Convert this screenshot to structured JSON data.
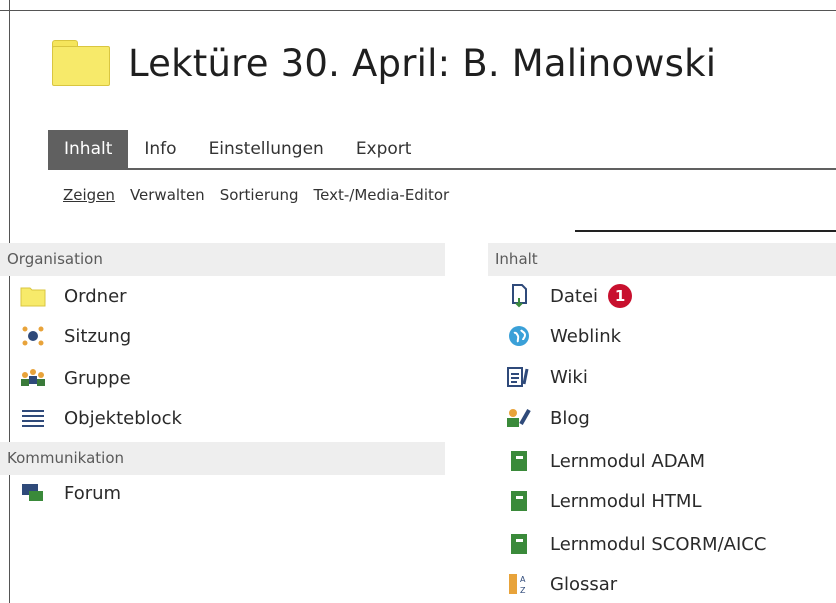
{
  "header": {
    "title": "Lektüre 30. April: B. Malinowski",
    "folder_color": "#f7ea6a"
  },
  "tabs": [
    {
      "label": "Inhalt",
      "active": true
    },
    {
      "label": "Info"
    },
    {
      "label": "Einstellungen"
    },
    {
      "label": "Export"
    }
  ],
  "subtabs": [
    {
      "label": "Zeigen",
      "active": true
    },
    {
      "label": "Verwalten"
    },
    {
      "label": "Sortierung"
    },
    {
      "label": "Text-/Media-Editor"
    }
  ],
  "left": {
    "organisation_label": "Organisation",
    "organisation_items": [
      {
        "label": "Ordner",
        "icon": "folder-icon"
      },
      {
        "label": "Sitzung",
        "icon": "session-icon"
      },
      {
        "label": "Gruppe",
        "icon": "group-icon"
      },
      {
        "label": "Objekteblock",
        "icon": "list-icon"
      }
    ],
    "kommunikation_label": "Kommunikation",
    "kommunikation_items": [
      {
        "label": "Forum",
        "icon": "forum-icon"
      }
    ]
  },
  "right": {
    "inhalt_label": "Inhalt",
    "items": [
      {
        "label": "Datei",
        "icon": "file-download-icon",
        "badge": "1"
      },
      {
        "label": "Weblink",
        "icon": "globe-icon"
      },
      {
        "label": "Wiki",
        "icon": "wiki-icon"
      },
      {
        "label": "Blog",
        "icon": "blog-icon"
      },
      {
        "label": "Lernmodul ADAM",
        "icon": "book-icon"
      },
      {
        "label": "Lernmodul HTML",
        "icon": "book-icon"
      },
      {
        "label": "Lernmodul SCORM/AICC",
        "icon": "book-icon"
      },
      {
        "label": "Glossar",
        "icon": "glossary-icon"
      }
    ]
  },
  "colors": {
    "badge": "#c8102e",
    "tab_active": "#606060",
    "book_green": "#3a8a3a"
  }
}
